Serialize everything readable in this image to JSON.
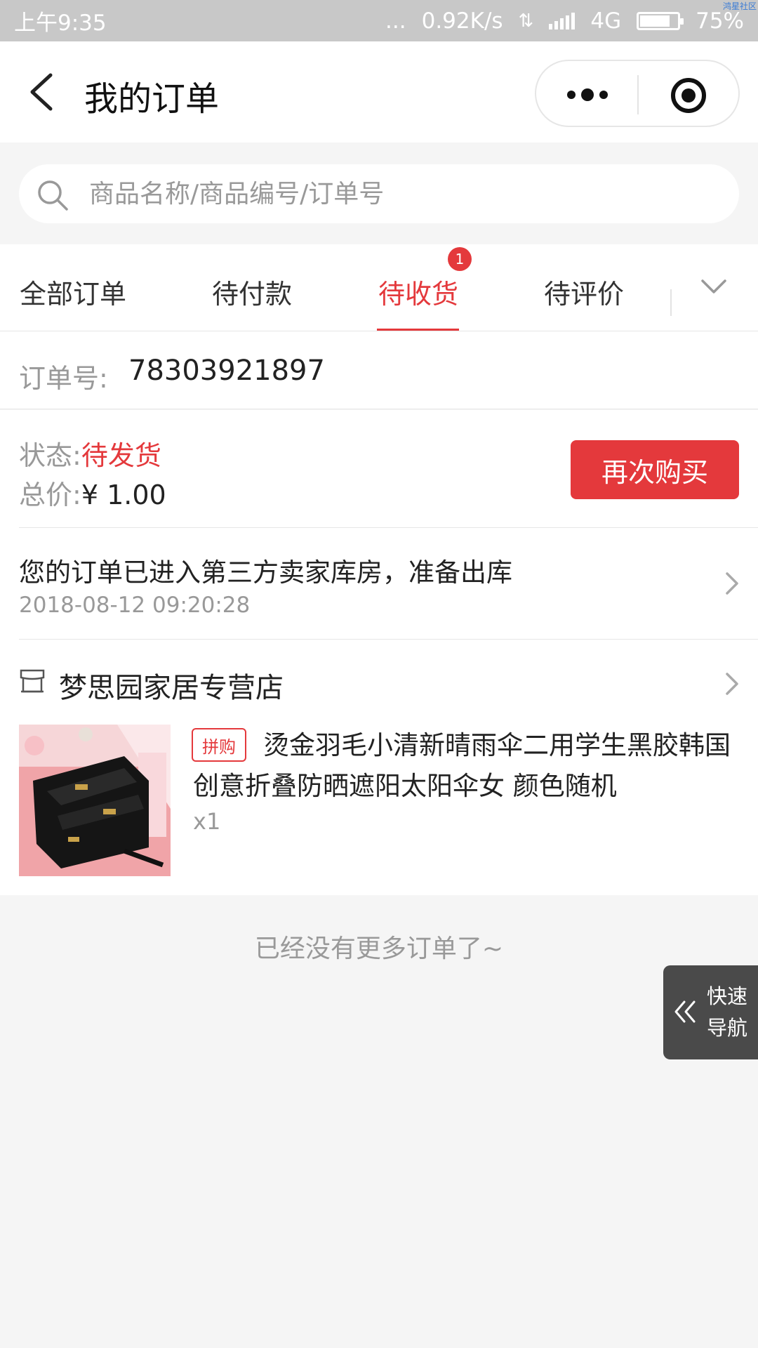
{
  "status_bar": {
    "time": "上午9:35",
    "dots": "...",
    "speed": "0.92K/s",
    "network": "4G",
    "battery": "75%",
    "watermark": "鸿星社区"
  },
  "header": {
    "title": "我的订单"
  },
  "search": {
    "placeholder": "商品名称/商品编号/订单号"
  },
  "tabs": {
    "items": [
      {
        "label": "全部订单",
        "active": false
      },
      {
        "label": "待付款",
        "active": false
      },
      {
        "label": "待收货",
        "active": true
      },
      {
        "label": "待评价",
        "active": false
      }
    ],
    "badge_count": "1"
  },
  "order": {
    "number_label": "订单号:",
    "number": "78303921897",
    "status_label": "状态:",
    "status": "待发货",
    "price_label": "总价:",
    "price": "¥ 1.00",
    "rebuy_label": "再次购买",
    "tracking_message": "您的订单已进入第三方卖家库房，准备出库",
    "tracking_time": "2018-08-12 09:20:28",
    "store_name": "梦思园家居专营店",
    "product": {
      "tag": "拼购",
      "title": "烫金羽毛小清新晴雨伞二用学生黑胶韩国创意折叠防晒遮阳太阳伞女 颜色随机",
      "quantity": "x1"
    }
  },
  "footer": {
    "no_more": "已经没有更多订单了~"
  },
  "quick_nav": {
    "label": "快速导航"
  },
  "colors": {
    "accent": "#e4393c",
    "background": "#f5f5f5",
    "status_bar": "#c8c8c8",
    "quick_nav": "#4a4a4a"
  }
}
